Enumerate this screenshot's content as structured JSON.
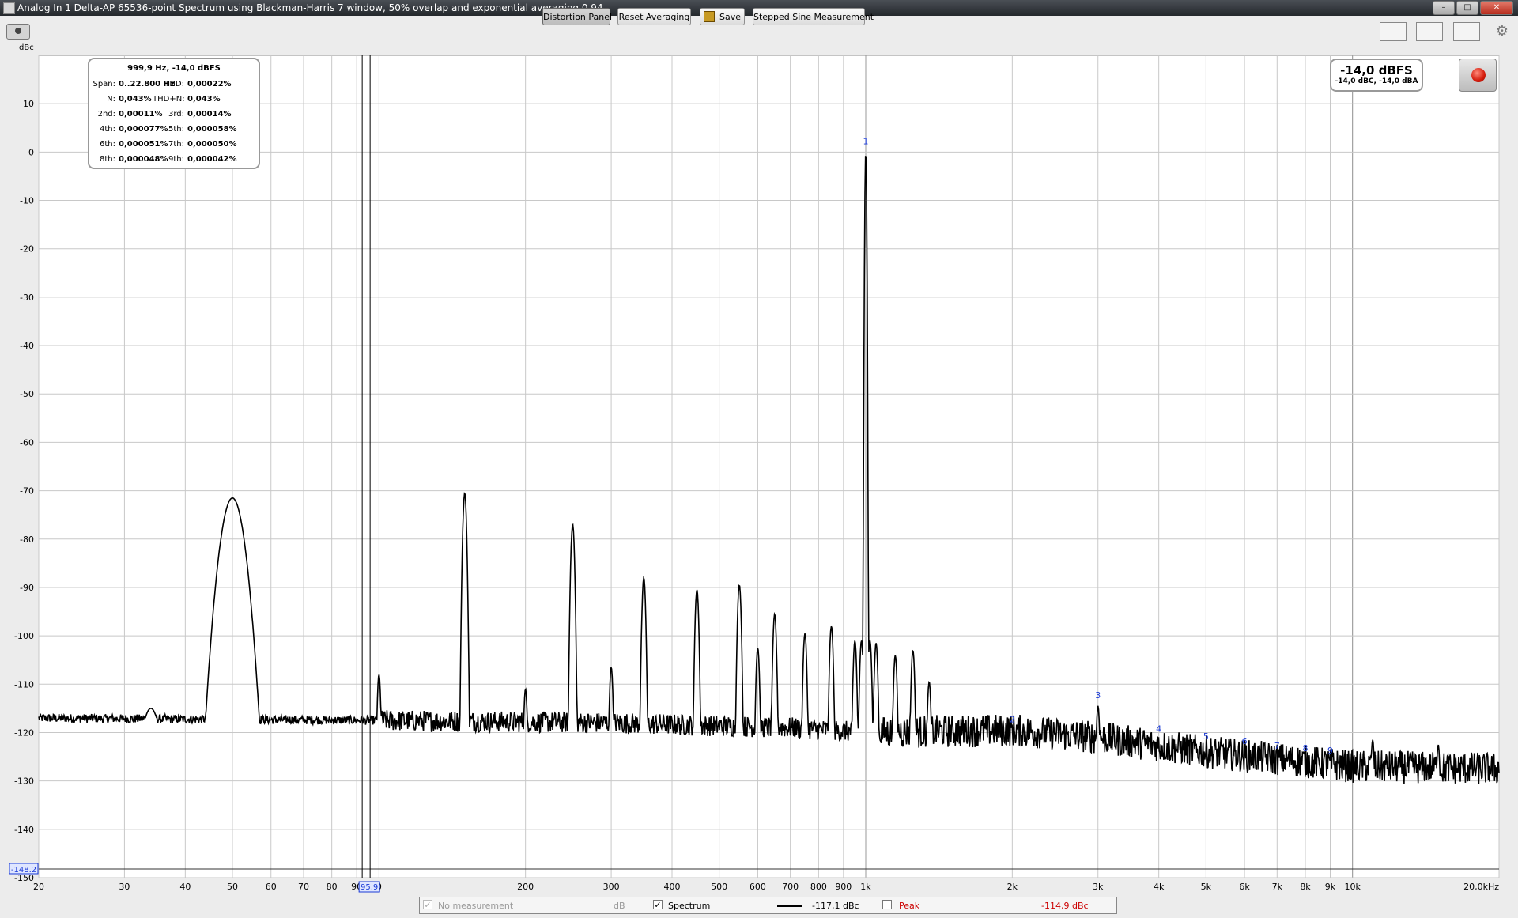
{
  "window": {
    "title": "Analog In 1 Delta-AP 65536-point Spectrum using Blackman-Harris 7 window, 50% overlap and exponential averaging 0,94"
  },
  "toolbar": {
    "distortion_panel": "Distortion Panel",
    "reset_averaging": "Reset Averaging",
    "save": "Save",
    "stepped_sine": "Stepped Sine Measurement"
  },
  "distortion": {
    "header": "999,9 Hz, -14,0 dBFS",
    "rows": [
      {
        "l1": "Span:",
        "v1": "0..22.800 Hz",
        "l2": "THD:",
        "v2": "0,00022%"
      },
      {
        "l1": "N:",
        "v1": "0,043%",
        "l2": "THD+N:",
        "v2": "0,043%"
      },
      {
        "l1": "2nd:",
        "v1": "0,00011%",
        "l2": "3rd:",
        "v2": "0,00014%"
      },
      {
        "l1": "4th:",
        "v1": "0,000077%",
        "l2": "5th:",
        "v2": "0,000058%"
      },
      {
        "l1": "6th:",
        "v1": "0,000051%",
        "l2": "7th:",
        "v2": "0,000050%"
      },
      {
        "l1": "8th:",
        "v1": "0,000048%",
        "l2": "9th:",
        "v2": "0,000042%"
      }
    ]
  },
  "level": {
    "main": "-14,0 dBFS",
    "sub": "-14,0 dBC, -14,0 dBA"
  },
  "legend": {
    "no_meas": "No measurement",
    "db": "dB",
    "spectrum": "Spectrum",
    "spectrum_val": "-117,1 dBc",
    "peak": "Peak",
    "peak_val": "-114,9 dBc"
  },
  "chart_data": {
    "type": "line",
    "ylabel": "dBc",
    "xunit": "Hz",
    "xscale": "log",
    "xlim": [
      20,
      20000
    ],
    "ylim": [
      -150,
      20
    ],
    "y_marker_value": -148.2,
    "y_marker_label": "-148.2",
    "cursor_x": 95.9,
    "cursor_label": "95,9",
    "yticks": [
      10,
      0,
      -10,
      -20,
      -30,
      -40,
      -50,
      -60,
      -70,
      -80,
      -90,
      -100,
      -110,
      -120,
      -130,
      -140,
      -150
    ],
    "xtick_labels": [
      {
        "x": 20,
        "label": "20"
      },
      {
        "x": 30,
        "label": "30"
      },
      {
        "x": 40,
        "label": "40"
      },
      {
        "x": 50,
        "label": "50"
      },
      {
        "x": 60,
        "label": "60"
      },
      {
        "x": 70,
        "label": "70"
      },
      {
        "x": 80,
        "label": "80"
      },
      {
        "x": 90,
        "label": "90"
      },
      {
        "x": 100,
        "label": "0"
      },
      {
        "x": 200,
        "label": "200"
      },
      {
        "x": 300,
        "label": "300"
      },
      {
        "x": 400,
        "label": "400"
      },
      {
        "x": 500,
        "label": "500"
      },
      {
        "x": 600,
        "label": "600"
      },
      {
        "x": 700,
        "label": "700"
      },
      {
        "x": 800,
        "label": "800"
      },
      {
        "x": 900,
        "label": "900"
      },
      {
        "x": 1000,
        "label": "1k"
      },
      {
        "x": 2000,
        "label": "2k"
      },
      {
        "x": 3000,
        "label": "3k"
      },
      {
        "x": 4000,
        "label": "4k"
      },
      {
        "x": 5000,
        "label": "5k"
      },
      {
        "x": 6000,
        "label": "6k"
      },
      {
        "x": 7000,
        "label": "7k"
      },
      {
        "x": 8000,
        "label": "8k"
      },
      {
        "x": 9000,
        "label": "9k"
      },
      {
        "x": 10000,
        "label": "10k"
      },
      {
        "x": 20000,
        "label": "20,0kHz"
      }
    ],
    "noise_floor": [
      [
        20,
        -117
      ],
      [
        100,
        -117.5
      ],
      [
        300,
        -118
      ],
      [
        700,
        -119
      ],
      [
        1000,
        -120
      ],
      [
        2000,
        -119.5
      ],
      [
        3000,
        -121
      ],
      [
        5000,
        -124
      ],
      [
        10000,
        -127
      ],
      [
        20000,
        -127.5
      ]
    ],
    "peaks": [
      {
        "x": 34,
        "y": -115
      },
      {
        "x": 50,
        "y": -71.5
      },
      {
        "x": 100,
        "y": -108
      },
      {
        "x": 150,
        "y": -70.5
      },
      {
        "x": 200,
        "y": -111
      },
      {
        "x": 250,
        "y": -77
      },
      {
        "x": 300,
        "y": -106.5
      },
      {
        "x": 350,
        "y": -88
      },
      {
        "x": 450,
        "y": -90.5
      },
      {
        "x": 550,
        "y": -89.5
      },
      {
        "x": 600,
        "y": -102.5
      },
      {
        "x": 650,
        "y": -95.5
      },
      {
        "x": 750,
        "y": -99.5
      },
      {
        "x": 850,
        "y": -98
      },
      {
        "x": 950,
        "y": -101
      },
      {
        "x": 980,
        "y": -101
      },
      {
        "x": 1000,
        "y": 0
      },
      {
        "x": 1020,
        "y": -101
      },
      {
        "x": 1050,
        "y": -101.5
      },
      {
        "x": 1150,
        "y": -104
      },
      {
        "x": 1250,
        "y": -103
      },
      {
        "x": 1350,
        "y": -109.5
      },
      {
        "x": 3000,
        "y": -114.5
      },
      {
        "x": 11000,
        "y": -121.5
      },
      {
        "x": 15000,
        "y": -122.5
      }
    ],
    "harmonic_markers": [
      {
        "x": 1000,
        "y": 0,
        "label": "1"
      },
      {
        "x": 2000,
        "y": -119.5,
        "label": "2"
      },
      {
        "x": 3000,
        "y": -114.5,
        "label": "3"
      },
      {
        "x": 4000,
        "y": -121.5,
        "label": "4"
      },
      {
        "x": 5000,
        "y": -123,
        "label": "5"
      },
      {
        "x": 6000,
        "y": -124,
        "label": "6"
      },
      {
        "x": 7000,
        "y": -125,
        "label": "7"
      },
      {
        "x": 8000,
        "y": -125.5,
        "label": "8"
      },
      {
        "x": 9000,
        "y": -126,
        "label": "9"
      }
    ],
    "colors": {
      "trace": "#000000",
      "harmonic_label": "#1a3ad6",
      "peak_legend": "#cc0000",
      "grid": "#c8c8c8",
      "background": "#ffffff"
    }
  }
}
